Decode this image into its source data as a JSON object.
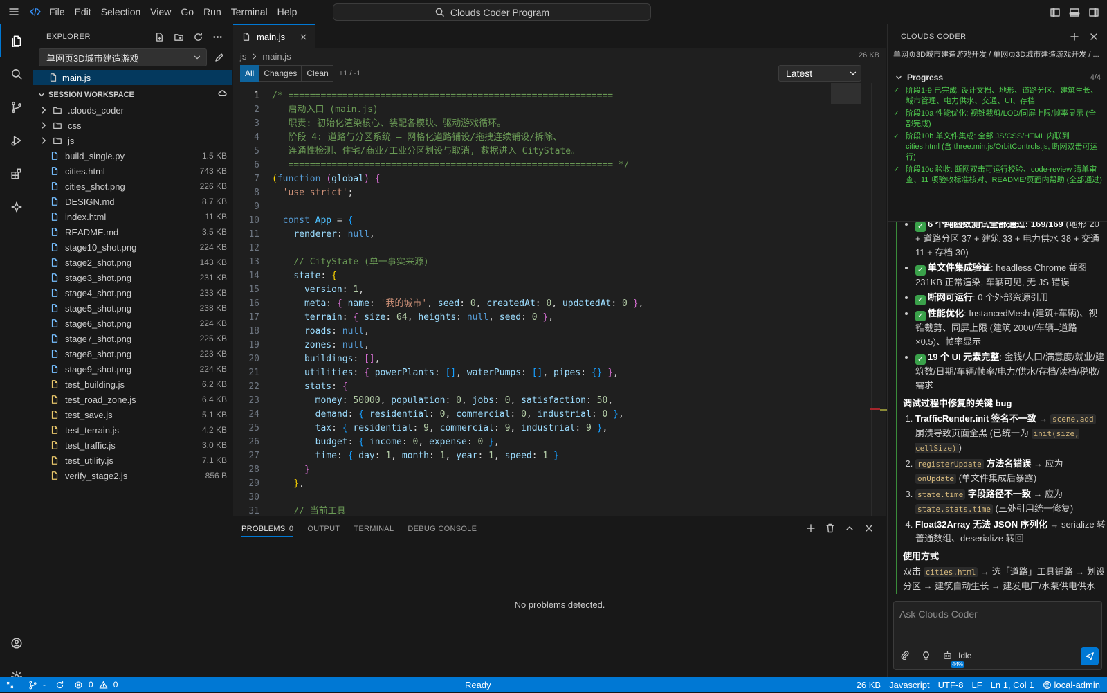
{
  "menu": {
    "items": [
      "File",
      "Edit",
      "Selection",
      "View",
      "Go",
      "Run",
      "Terminal",
      "Help"
    ]
  },
  "command_center": {
    "label": "Clouds Coder Program"
  },
  "explorer": {
    "title": "EXPLORER",
    "project": "单网页3D城市建造游戏",
    "open_file": "main.js",
    "workspace_title": "SESSION WORKSPACE",
    "items": [
      {
        "name": ".clouds_coder",
        "type": "folder",
        "size": ""
      },
      {
        "name": "css",
        "type": "folder",
        "size": ""
      },
      {
        "name": "js",
        "type": "folder",
        "size": ""
      },
      {
        "name": "build_single.py",
        "type": "py",
        "size": "1.5 KB"
      },
      {
        "name": "cities.html",
        "type": "html",
        "size": "743 KB"
      },
      {
        "name": "cities_shot.png",
        "type": "png",
        "size": "226 KB"
      },
      {
        "name": "DESIGN.md",
        "type": "md",
        "size": "8.7 KB"
      },
      {
        "name": "index.html",
        "type": "html",
        "size": "11 KB"
      },
      {
        "name": "README.md",
        "type": "md",
        "size": "3.5 KB"
      },
      {
        "name": "stage10_shot.png",
        "type": "png",
        "size": "224 KB"
      },
      {
        "name": "stage2_shot.png",
        "type": "png",
        "size": "143 KB"
      },
      {
        "name": "stage3_shot.png",
        "type": "png",
        "size": "231 KB"
      },
      {
        "name": "stage4_shot.png",
        "type": "png",
        "size": "233 KB"
      },
      {
        "name": "stage5_shot.png",
        "type": "png",
        "size": "238 KB"
      },
      {
        "name": "stage6_shot.png",
        "type": "png",
        "size": "224 KB"
      },
      {
        "name": "stage7_shot.png",
        "type": "png",
        "size": "225 KB"
      },
      {
        "name": "stage8_shot.png",
        "type": "png",
        "size": "223 KB"
      },
      {
        "name": "stage9_shot.png",
        "type": "png",
        "size": "224 KB"
      },
      {
        "name": "test_building.js",
        "type": "js",
        "size": "6.2 KB"
      },
      {
        "name": "test_road_zone.js",
        "type": "js",
        "size": "6.4 KB"
      },
      {
        "name": "test_save.js",
        "type": "js",
        "size": "5.1 KB"
      },
      {
        "name": "test_terrain.js",
        "type": "js",
        "size": "4.2 KB"
      },
      {
        "name": "test_traffic.js",
        "type": "js",
        "size": "3.0 KB"
      },
      {
        "name": "test_utility.js",
        "type": "js",
        "size": "7.1 KB"
      },
      {
        "name": "verify_stage2.js",
        "type": "js",
        "size": "856 B"
      }
    ]
  },
  "editor": {
    "tab": "main.js",
    "breadcrumb": [
      "js",
      "main.js"
    ],
    "file_size": "26 KB",
    "diff_modes": [
      "All",
      "Changes",
      "Clean"
    ],
    "diff_stat": "+1 / -1",
    "version": "Latest",
    "lines": [
      [
        [
          "c-com",
          "/* ============================================================"
        ]
      ],
      [
        [
          "c-com",
          "   启动入口 (main.js)"
        ]
      ],
      [
        [
          "c-com",
          "   职责: 初始化渲染核心、装配各模块、驱动游戏循环。"
        ]
      ],
      [
        [
          "c-com",
          "   阶段 4: 道路与分区系统 — 网格化道路铺设/拖拽连续铺设/拆除、"
        ]
      ],
      [
        [
          "c-com",
          "   连通性检测、住宅/商业/工业分区划设与取消, 数据进入 CityState。"
        ]
      ],
      [
        [
          "c-com",
          "   ============================================================ */"
        ]
      ],
      [
        [
          "c-p1",
          "("
        ],
        [
          "c-kw",
          "function"
        ],
        [
          "c-def",
          " "
        ],
        [
          "c-p2",
          "("
        ],
        [
          "c-prop",
          "global"
        ],
        [
          "c-p2",
          ")"
        ],
        [
          "c-def",
          " "
        ],
        [
          "c-p2",
          "{"
        ]
      ],
      [
        [
          "c-def",
          "  "
        ],
        [
          "c-str",
          "'use strict'"
        ],
        [
          "c-def",
          ";"
        ]
      ],
      [
        [
          "c-def",
          ""
        ]
      ],
      [
        [
          "c-def",
          "  "
        ],
        [
          "c-kw",
          "const"
        ],
        [
          "c-def",
          " "
        ],
        [
          "c-var",
          "App"
        ],
        [
          "c-def",
          " = "
        ],
        [
          "c-p3",
          "{"
        ]
      ],
      [
        [
          "c-def",
          "    "
        ],
        [
          "c-prop",
          "renderer"
        ],
        [
          "c-def",
          ": "
        ],
        [
          "c-kw",
          "null"
        ],
        [
          "c-def",
          ","
        ]
      ],
      [
        [
          "c-def",
          ""
        ]
      ],
      [
        [
          "c-def",
          "    "
        ],
        [
          "c-com",
          "// CityState (单一事实来源)"
        ]
      ],
      [
        [
          "c-def",
          "    "
        ],
        [
          "c-prop",
          "state"
        ],
        [
          "c-def",
          ": "
        ],
        [
          "c-p1",
          "{"
        ]
      ],
      [
        [
          "c-def",
          "      "
        ],
        [
          "c-prop",
          "version"
        ],
        [
          "c-def",
          ": "
        ],
        [
          "c-num",
          "1"
        ],
        [
          "c-def",
          ","
        ]
      ],
      [
        [
          "c-def",
          "      "
        ],
        [
          "c-prop",
          "meta"
        ],
        [
          "c-def",
          ": "
        ],
        [
          "c-p2",
          "{"
        ],
        [
          "c-def",
          " "
        ],
        [
          "c-prop",
          "name"
        ],
        [
          "c-def",
          ": "
        ],
        [
          "c-str",
          "'我的城市'"
        ],
        [
          "c-def",
          ", "
        ],
        [
          "c-prop",
          "seed"
        ],
        [
          "c-def",
          ": "
        ],
        [
          "c-num",
          "0"
        ],
        [
          "c-def",
          ", "
        ],
        [
          "c-prop",
          "createdAt"
        ],
        [
          "c-def",
          ": "
        ],
        [
          "c-num",
          "0"
        ],
        [
          "c-def",
          ", "
        ],
        [
          "c-prop",
          "updatedAt"
        ],
        [
          "c-def",
          ": "
        ],
        [
          "c-num",
          "0"
        ],
        [
          "c-def",
          " "
        ],
        [
          "c-p2",
          "}"
        ],
        [
          "c-def",
          ","
        ]
      ],
      [
        [
          "c-def",
          "      "
        ],
        [
          "c-prop",
          "terrain"
        ],
        [
          "c-def",
          ": "
        ],
        [
          "c-p2",
          "{"
        ],
        [
          "c-def",
          " "
        ],
        [
          "c-prop",
          "size"
        ],
        [
          "c-def",
          ": "
        ],
        [
          "c-num",
          "64"
        ],
        [
          "c-def",
          ", "
        ],
        [
          "c-prop",
          "heights"
        ],
        [
          "c-def",
          ": "
        ],
        [
          "c-kw",
          "null"
        ],
        [
          "c-def",
          ", "
        ],
        [
          "c-prop",
          "seed"
        ],
        [
          "c-def",
          ": "
        ],
        [
          "c-num",
          "0"
        ],
        [
          "c-def",
          " "
        ],
        [
          "c-p2",
          "}"
        ],
        [
          "c-def",
          ","
        ]
      ],
      [
        [
          "c-def",
          "      "
        ],
        [
          "c-prop",
          "roads"
        ],
        [
          "c-def",
          ": "
        ],
        [
          "c-kw",
          "null"
        ],
        [
          "c-def",
          ","
        ]
      ],
      [
        [
          "c-def",
          "      "
        ],
        [
          "c-prop",
          "zones"
        ],
        [
          "c-def",
          ": "
        ],
        [
          "c-kw",
          "null"
        ],
        [
          "c-def",
          ","
        ]
      ],
      [
        [
          "c-def",
          "      "
        ],
        [
          "c-prop",
          "buildings"
        ],
        [
          "c-def",
          ": "
        ],
        [
          "c-p2",
          "[]"
        ],
        [
          "c-def",
          ","
        ]
      ],
      [
        [
          "c-def",
          "      "
        ],
        [
          "c-prop",
          "utilities"
        ],
        [
          "c-def",
          ": "
        ],
        [
          "c-p2",
          "{"
        ],
        [
          "c-def",
          " "
        ],
        [
          "c-prop",
          "powerPlants"
        ],
        [
          "c-def",
          ": "
        ],
        [
          "c-p3",
          "[]"
        ],
        [
          "c-def",
          ", "
        ],
        [
          "c-prop",
          "waterPumps"
        ],
        [
          "c-def",
          ": "
        ],
        [
          "c-p3",
          "[]"
        ],
        [
          "c-def",
          ", "
        ],
        [
          "c-prop",
          "pipes"
        ],
        [
          "c-def",
          ": "
        ],
        [
          "c-p3",
          "{}"
        ],
        [
          "c-def",
          " "
        ],
        [
          "c-p2",
          "}"
        ],
        [
          "c-def",
          ","
        ]
      ],
      [
        [
          "c-def",
          "      "
        ],
        [
          "c-prop",
          "stats"
        ],
        [
          "c-def",
          ": "
        ],
        [
          "c-p2",
          "{"
        ]
      ],
      [
        [
          "c-def",
          "        "
        ],
        [
          "c-prop",
          "money"
        ],
        [
          "c-def",
          ": "
        ],
        [
          "c-num",
          "50000"
        ],
        [
          "c-def",
          ", "
        ],
        [
          "c-prop",
          "population"
        ],
        [
          "c-def",
          ": "
        ],
        [
          "c-num",
          "0"
        ],
        [
          "c-def",
          ", "
        ],
        [
          "c-prop",
          "jobs"
        ],
        [
          "c-def",
          ": "
        ],
        [
          "c-num",
          "0"
        ],
        [
          "c-def",
          ", "
        ],
        [
          "c-prop",
          "satisfaction"
        ],
        [
          "c-def",
          ": "
        ],
        [
          "c-num",
          "50"
        ],
        [
          "c-def",
          ","
        ]
      ],
      [
        [
          "c-def",
          "        "
        ],
        [
          "c-prop",
          "demand"
        ],
        [
          "c-def",
          ": "
        ],
        [
          "c-p3",
          "{"
        ],
        [
          "c-def",
          " "
        ],
        [
          "c-prop",
          "residential"
        ],
        [
          "c-def",
          ": "
        ],
        [
          "c-num",
          "0"
        ],
        [
          "c-def",
          ", "
        ],
        [
          "c-prop",
          "commercial"
        ],
        [
          "c-def",
          ": "
        ],
        [
          "c-num",
          "0"
        ],
        [
          "c-def",
          ", "
        ],
        [
          "c-prop",
          "industrial"
        ],
        [
          "c-def",
          ": "
        ],
        [
          "c-num",
          "0"
        ],
        [
          "c-def",
          " "
        ],
        [
          "c-p3",
          "}"
        ],
        [
          "c-def",
          ","
        ]
      ],
      [
        [
          "c-def",
          "        "
        ],
        [
          "c-prop",
          "tax"
        ],
        [
          "c-def",
          ": "
        ],
        [
          "c-p3",
          "{"
        ],
        [
          "c-def",
          " "
        ],
        [
          "c-prop",
          "residential"
        ],
        [
          "c-def",
          ": "
        ],
        [
          "c-num",
          "9"
        ],
        [
          "c-def",
          ", "
        ],
        [
          "c-prop",
          "commercial"
        ],
        [
          "c-def",
          ": "
        ],
        [
          "c-num",
          "9"
        ],
        [
          "c-def",
          ", "
        ],
        [
          "c-prop",
          "industrial"
        ],
        [
          "c-def",
          ": "
        ],
        [
          "c-num",
          "9"
        ],
        [
          "c-def",
          " "
        ],
        [
          "c-p3",
          "}"
        ],
        [
          "c-def",
          ","
        ]
      ],
      [
        [
          "c-def",
          "        "
        ],
        [
          "c-prop",
          "budget"
        ],
        [
          "c-def",
          ": "
        ],
        [
          "c-p3",
          "{"
        ],
        [
          "c-def",
          " "
        ],
        [
          "c-prop",
          "income"
        ],
        [
          "c-def",
          ": "
        ],
        [
          "c-num",
          "0"
        ],
        [
          "c-def",
          ", "
        ],
        [
          "c-prop",
          "expense"
        ],
        [
          "c-def",
          ": "
        ],
        [
          "c-num",
          "0"
        ],
        [
          "c-def",
          " "
        ],
        [
          "c-p3",
          "}"
        ],
        [
          "c-def",
          ","
        ]
      ],
      [
        [
          "c-def",
          "        "
        ],
        [
          "c-prop",
          "time"
        ],
        [
          "c-def",
          ": "
        ],
        [
          "c-p3",
          "{"
        ],
        [
          "c-def",
          " "
        ],
        [
          "c-prop",
          "day"
        ],
        [
          "c-def",
          ": "
        ],
        [
          "c-num",
          "1"
        ],
        [
          "c-def",
          ", "
        ],
        [
          "c-prop",
          "month"
        ],
        [
          "c-def",
          ": "
        ],
        [
          "c-num",
          "1"
        ],
        [
          "c-def",
          ", "
        ],
        [
          "c-prop",
          "year"
        ],
        [
          "c-def",
          ": "
        ],
        [
          "c-num",
          "1"
        ],
        [
          "c-def",
          ", "
        ],
        [
          "c-prop",
          "speed"
        ],
        [
          "c-def",
          ": "
        ],
        [
          "c-num",
          "1"
        ],
        [
          "c-def",
          " "
        ],
        [
          "c-p3",
          "}"
        ]
      ],
      [
        [
          "c-def",
          "      "
        ],
        [
          "c-p2",
          "}"
        ]
      ],
      [
        [
          "c-def",
          "    "
        ],
        [
          "c-p1",
          "}"
        ],
        [
          "c-def",
          ","
        ]
      ],
      [
        [
          "c-def",
          ""
        ]
      ],
      [
        [
          "c-def",
          "    "
        ],
        [
          "c-com",
          "// 当前工具"
        ]
      ]
    ]
  },
  "panel": {
    "tabs": [
      "PROBLEMS",
      "OUTPUT",
      "TERMINAL",
      "DEBUG CONSOLE"
    ],
    "problems_count": "0",
    "message": "No problems detected."
  },
  "chat": {
    "title": "CLOUDS CODER",
    "breadcrumb": "单网页3D城市建造游戏开发 / 单网页3D城市建造游戏开发 / ...",
    "progress_title": "Progress",
    "progress_count": "4/4",
    "progress_items": [
      "阶段1-9 已完成: 设计文档、地形、道路分区、建筑生长、城市管理、电力供水、交通、UI、存档",
      "阶段10a 性能优化: 视锥裁剪/LOD/同屏上限/帧率显示 (全部完成)",
      "阶段10b 单文件集成: 全部 JS/CSS/HTML 内联到 cities.html (含 three.min.js/OrbitControls.js, 断网双击可运行)",
      "阶段10c 验收: 断网双击可运行校验、code-review 清单审查、11 项验收标准核对、README/页面内帮助 (全部通过)"
    ],
    "bullets": [
      {
        "b": "6 个纯函数测试全部通过: 169/169",
        "t": " (地形 20 + 道路分区 37 + 建筑 33 + 电力供水 38 + 交通 11 + 存档 30)"
      },
      {
        "b": "单文件集成验证",
        "t": ": headless Chrome 截图 231KB 正常渲染, 车辆可见, 无 JS 错误"
      },
      {
        "b": "断网可运行",
        "t": ": 0 个外部资源引用"
      },
      {
        "b": "性能优化",
        "t": ": InstancedMesh (建筑+车辆)、视锥裁剪、同屏上限 (建筑 2000/车辆=道路×0.5)、帧率显示"
      },
      {
        "b": "19 个 UI 元素完整",
        "t": ": 金钱/人口/满意度/就业/建筑数/日期/车辆/帧率/电力/供水/存档/读档/税收/需求"
      }
    ],
    "bugs_title": "调试过程中修复的关键 bug",
    "bugs": [
      {
        "b": "TrafficRender.init 签名不一致",
        "t1": " → ",
        "c1": "scene.add",
        "t2": " 崩溃导致页面全黑 (已统一为 ",
        "c2": "init(size, cellSize)",
        "t3": ")"
      },
      {
        "b": "",
        "c0": "registerUpdate",
        "b2": " 方法名错误",
        "t1": " → 应为 ",
        "c1": "onUpdate",
        "t2": " (单文件集成后暴露)"
      },
      {
        "b": "",
        "c0": "state.time",
        "b2": " 字段路径不一致",
        "t1": " → 应为 ",
        "c1": "state.stats.time",
        "t2": " (三处引用统一修复)"
      },
      {
        "b": "Float32Array 无法 JSON 序列化",
        "t1": " → serialize 转普通数组、deserialize 转回"
      }
    ],
    "usage_title": "使用方式",
    "usage_pre": "双击 ",
    "usage_code": "cities.html",
    "usage_post": " → 选「道路」工具铺路 → 划设分区 → 建筑自动生长 → 建发电厂/水泵供电供水 → 管理税收与速度 → 定期存档。",
    "input_placeholder": "Ask Clouds Coder",
    "context_pct": "44%",
    "status": "Idle"
  },
  "statusbar": {
    "branch_label": "-",
    "errors": "0",
    "warnings": "0",
    "center": "Ready",
    "size": "26 KB",
    "language": "Javascript",
    "encoding": "UTF-8",
    "eol": "LF",
    "position": "Ln 1, Col 1",
    "user": "local-admin"
  }
}
